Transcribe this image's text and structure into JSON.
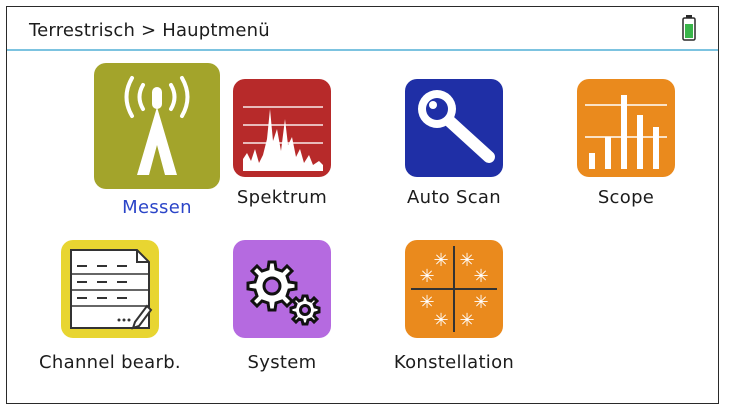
{
  "header": {
    "breadcrumb": "Terrestrisch > Hauptmenü",
    "battery_icon": "battery-full-icon"
  },
  "menu": {
    "items": [
      {
        "label": "Messen",
        "icon": "antenna-icon",
        "color": "#a3a42b",
        "selected": true
      },
      {
        "label": "Spektrum",
        "icon": "spectrum-icon",
        "color": "#b72a2a",
        "selected": false
      },
      {
        "label": "Auto Scan",
        "icon": "magnifier-icon",
        "color": "#1f2fa6",
        "selected": false
      },
      {
        "label": "Scope",
        "icon": "bar-chart-icon",
        "color": "#ea8a1d",
        "selected": false
      },
      {
        "label": "Channel bearb.",
        "icon": "channel-list-icon",
        "color": "#e8d531",
        "selected": false
      },
      {
        "label": "System",
        "icon": "gears-icon",
        "color": "#b56ae0",
        "selected": false
      },
      {
        "label": "Konstellation",
        "icon": "constellation-icon",
        "color": "#ea8a1d",
        "selected": false
      }
    ]
  },
  "colors": {
    "accent": "#2b45c8",
    "header_line": "#7cc3e0",
    "battery": "#39b54a"
  }
}
